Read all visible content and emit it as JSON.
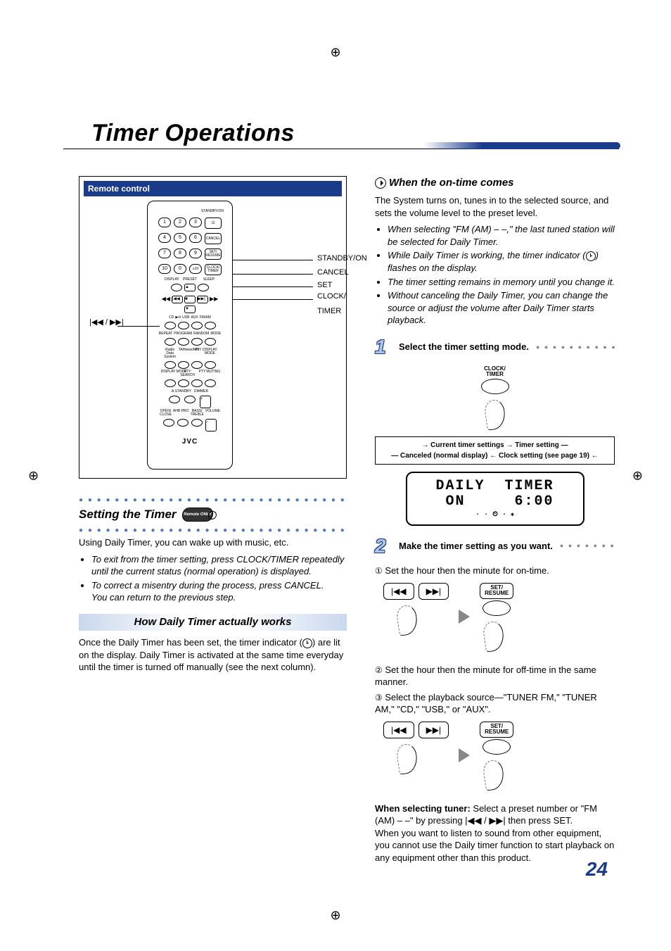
{
  "page_number": "24",
  "title": "Timer Operations",
  "remote_box": {
    "header": "Remote control",
    "left_label": "|◀◀ / ▶▶|",
    "right_labels": [
      "STANDBY/ON",
      "CANCEL",
      "SET",
      "CLOCK/\nTIMER"
    ],
    "brand": "JVC",
    "button_rows": {
      "top_label": "STANDBY/ON",
      "numbers": [
        "1",
        "2",
        "3",
        "4",
        "5",
        "6",
        "7",
        "8",
        "9",
        "10",
        "0",
        "≥10"
      ],
      "set_resume": "SET/\nRESUME",
      "cancel": "CANCEL",
      "clock_timer": "CLOCK/\nTIMER",
      "display": "DISPLAY",
      "preset": "PRESET",
      "sleep": "SLEEP",
      "transport": [
        "|◀◀",
        "■",
        "▶▶|"
      ],
      "play": "▶/⏸",
      "stop": "■",
      "src": [
        "CD",
        "USB",
        "AUX",
        "FM/AM"
      ],
      "repeat": "REPEAT",
      "program": "PROGRAM",
      "random": "RANDOM",
      "muting": "MUTING",
      "mode": "MODE",
      "rds": "Radio Data System",
      "ta": "TA/News/Info",
      "pty": "PTY",
      "pm": "DISPLAY MODE",
      "ptysearch": "PTY SEARCH",
      "astandby": "A.STANDBY",
      "dimmer": "DIMMER",
      "openclose": "OPEN/\nCLOSE",
      "ahbpro": "AHB PRO",
      "basstreble": "BASS/\nTREBLE",
      "volume": "VOLUME"
    }
  },
  "left": {
    "section_title": "Setting the Timer",
    "badge": "Remote ONLY",
    "intro": "Using Daily Timer, you can wake up with music, etc.",
    "bullets": [
      "To exit from the timer setting, press CLOCK/TIMER repeatedly until the current status (normal operation) is displayed.",
      "To correct a misentry during the process, press CANCEL.\nYou can return to the previous step."
    ],
    "sub_header": "How Daily Timer actually works",
    "sub_text": "Once the Daily Timer has been set, the timer indicator (⏲) are lit on the display. Daily Timer is activated at the same time everyday until the timer is turned off manually (see the next column)."
  },
  "right": {
    "ontime_title": "When the on-time comes",
    "ontime_text": "The System turns on, tunes in to the selected source, and sets the volume level to the preset level.",
    "ontime_bullets": [
      "When selecting \"FM (AM) – –,\" the last tuned station will be selected for Daily Timer.",
      "While Daily Timer is working, the timer indicator (⏲) flashes on the display.",
      "The timer setting remains in memory until you change it.",
      "Without canceling the Daily Timer, you can change the source or adjust the volume after Daily Timer starts playback."
    ],
    "step1_label": "Select the timer setting mode.",
    "clock_timer_label": "CLOCK/\nTIMER",
    "flow": {
      "tl": "Current timer settings",
      "tr": "Timer setting",
      "bl": "Canceled (normal display)",
      "br": "Clock setting (see page 19)"
    },
    "lcd_line": "DAILY  TIMER\n ON     6:00",
    "step2_label": "Make the timer setting as you want.",
    "step2_1": "Set the hour then the minute for on-time.",
    "step2_2": "Set the hour then the minute for off-time in the same manner.",
    "step2_3": "Select the playback source—\"TUNER FM,\" \"TUNER AM,\" \"CD,\" \"USB,\" or \"AUX\".",
    "set_key": "SET/\nRESUME",
    "prev_key": "|◀◀",
    "next_key": "▶▶|",
    "tuner_note_bold": "When selecting tuner:",
    "tuner_note": " Select a preset number or \"FM (AM) – –\" by pressing |◀◀ / ▶▶| then press SET.\nWhen you want to listen to sound from other equipment, you cannot use the Daily timer function to start playback on any equipment other than this product.",
    "circ": {
      "1": "①",
      "2": "②",
      "3": "③"
    }
  }
}
